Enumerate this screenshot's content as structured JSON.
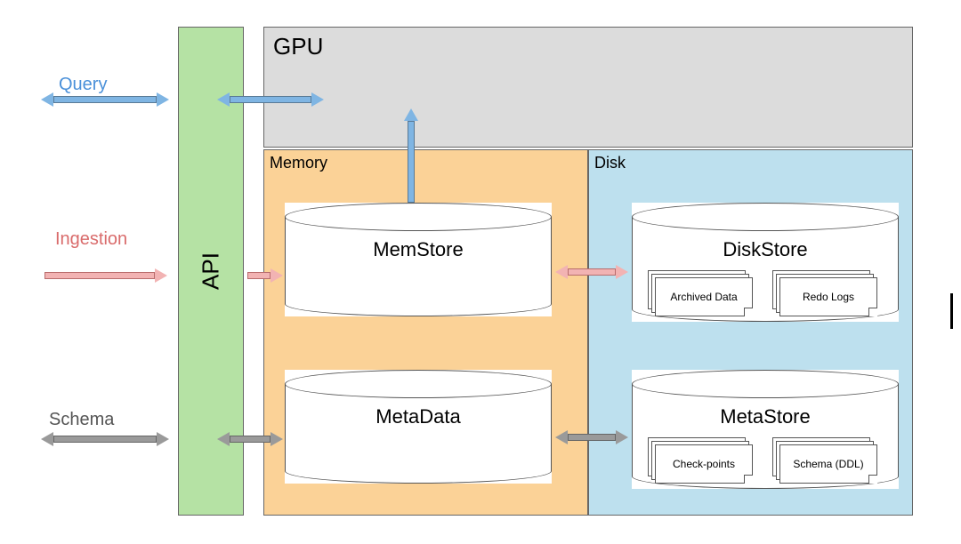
{
  "sideLabels": {
    "query": "Query",
    "ingestion": "Ingestion",
    "schema": "Schema"
  },
  "api": {
    "label": "API"
  },
  "gpu": {
    "label": "GPU"
  },
  "memory": {
    "label": "Memory",
    "memstore": {
      "title": "MemStore"
    },
    "metadata": {
      "title": "MetaData"
    }
  },
  "disk": {
    "label": "Disk",
    "diskstore": {
      "title": "DiskStore",
      "docs": [
        "Archived Data",
        "Redo Logs"
      ]
    },
    "metastore": {
      "title": "MetaStore",
      "docs": [
        "Check-points",
        "Schema (DDL)"
      ]
    }
  }
}
